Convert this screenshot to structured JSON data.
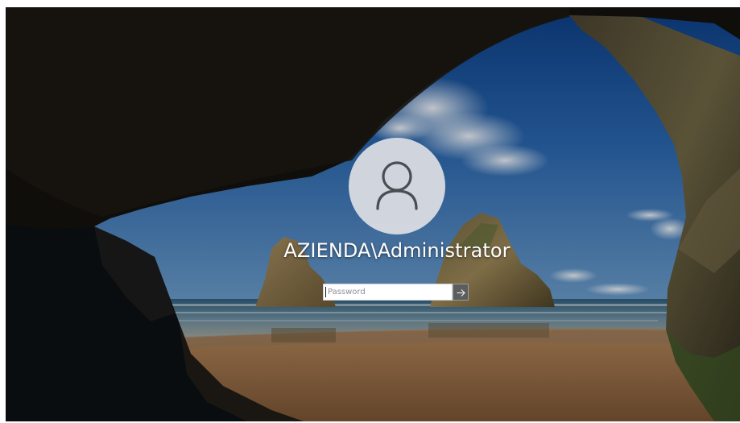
{
  "login": {
    "username": "AZIENDA\\Administrator",
    "password_placeholder": "Password"
  },
  "icons": {
    "avatar": "user-silhouette-icon",
    "submit": "arrow-right-icon"
  },
  "colors": {
    "avatar_circle": "#dee0e4",
    "avatar_glyph": "#4a4e53",
    "text": "#ffffff",
    "submit_button": "#5a5c5f"
  }
}
